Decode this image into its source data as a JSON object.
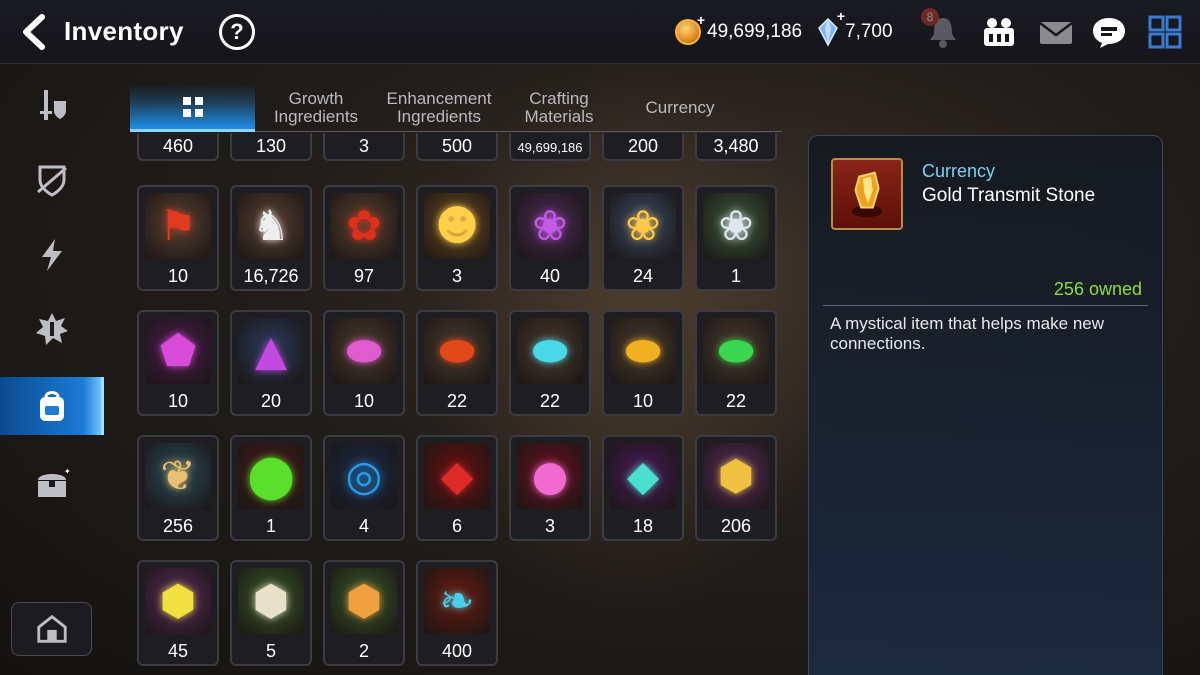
{
  "header": {
    "title": "Inventory",
    "help_symbol": "?",
    "gold_amount": "49,699,186",
    "gem_amount": "7,700",
    "notification_count": "8",
    "plus_symbol": "+"
  },
  "icons": {
    "back": "chevron-left-icon",
    "help": "question-icon",
    "gold": "gold-coin-icon",
    "gem": "crystal-gem-icon",
    "bell": "bell-icon",
    "friends": "friends-icon",
    "mail": "mail-icon",
    "chat": "chat-icon",
    "menu": "grid-menu-icon"
  },
  "sidenav": {
    "items": [
      {
        "name": "equipment",
        "icon": "sword-shield-icon",
        "active": false
      },
      {
        "name": "artifact",
        "icon": "broken-shield-icon",
        "active": false
      },
      {
        "name": "energy",
        "icon": "lightning-icon",
        "active": false
      },
      {
        "name": "catalyst",
        "icon": "spiky-gear-icon",
        "active": false
      },
      {
        "name": "items",
        "icon": "backpack-icon",
        "active": true
      },
      {
        "name": "storage",
        "icon": "chest-icon",
        "active": false
      }
    ],
    "bottom_button": "camp-icon"
  },
  "tabs": [
    {
      "label": "",
      "icon": "grid-icon",
      "active": true
    },
    {
      "label": "Growth Ingredients",
      "active": false
    },
    {
      "label": "Enhancement Ingredients",
      "active": false
    },
    {
      "label": "Crafting Materials",
      "active": false
    },
    {
      "label": "Currency",
      "active": false
    }
  ],
  "partial_row": [
    "460",
    "130",
    "3",
    "500",
    "49,699,186",
    "200",
    "3,480"
  ],
  "items": [
    {
      "count": "10",
      "icon": "red-banner-icon",
      "bg": "#5a4030"
    },
    {
      "count": "16,726",
      "icon": "white-horse-icon",
      "bg": "#5a4030"
    },
    {
      "count": "97",
      "icon": "red-flower-icon",
      "bg": "#5a4030"
    },
    {
      "count": "3",
      "icon": "golden-creature-icon",
      "bg": "#6b4a20"
    },
    {
      "count": "40",
      "icon": "purple-lotus-icon",
      "bg": "#4a2a55"
    },
    {
      "count": "24",
      "icon": "gold-lotus-icon",
      "bg": "#3a4a66"
    },
    {
      "count": "1",
      "icon": "silver-lotus-icon",
      "bg": "#3a5a3a"
    },
    {
      "count": "10",
      "icon": "purple-pentagon-gem-icon",
      "bg": "#4a1a4a"
    },
    {
      "count": "20",
      "icon": "purple-triangle-gem-icon",
      "bg": "#2a3a5a"
    },
    {
      "count": "10",
      "icon": "pink-oval-gem-icon",
      "bg": "#4a3a2e"
    },
    {
      "count": "22",
      "icon": "red-oval-gem-icon",
      "bg": "#4a3a2e"
    },
    {
      "count": "22",
      "icon": "cyan-oval-gem-icon",
      "bg": "#4a3a2e"
    },
    {
      "count": "10",
      "icon": "gold-oval-gem-icon",
      "bg": "#4a3a2e"
    },
    {
      "count": "22",
      "icon": "green-oval-gem-icon",
      "bg": "#4a3a2e"
    },
    {
      "count": "256",
      "icon": "golden-root-icon",
      "bg": "#2a4a5a"
    },
    {
      "count": "1",
      "icon": "green-potion-icon",
      "bg": "#4a1a1a"
    },
    {
      "count": "4",
      "icon": "blue-rune-disc-icon",
      "bg": "#1a2a4a"
    },
    {
      "count": "6",
      "icon": "red-crystal-hex-icon",
      "bg": "#6a1010"
    },
    {
      "count": "3",
      "icon": "pink-potion-hex-icon",
      "bg": "#6a1020"
    },
    {
      "count": "18",
      "icon": "teal-crystal-hex-icon",
      "bg": "#4a1a5a"
    },
    {
      "count": "206",
      "icon": "gold-rune-stone-icon",
      "bg": "#5a2a5a"
    },
    {
      "count": "45",
      "icon": "lightning-rune-stone-icon",
      "bg": "#5a2a5a"
    },
    {
      "count": "5",
      "icon": "star-rune-stone-icon",
      "bg": "#3a5a2a"
    },
    {
      "count": "2",
      "icon": "orange-rune-stone-icon",
      "bg": "#3a5a2a"
    },
    {
      "count": "400",
      "icon": "blue-feather-icon",
      "bg": "#6a1a10"
    }
  ],
  "detail": {
    "category": "Currency",
    "name": "Gold Transmit Stone",
    "owned": "256 owned",
    "description": "A mystical item that helps make new connections.",
    "icon": "gold-transmit-stone-icon"
  }
}
